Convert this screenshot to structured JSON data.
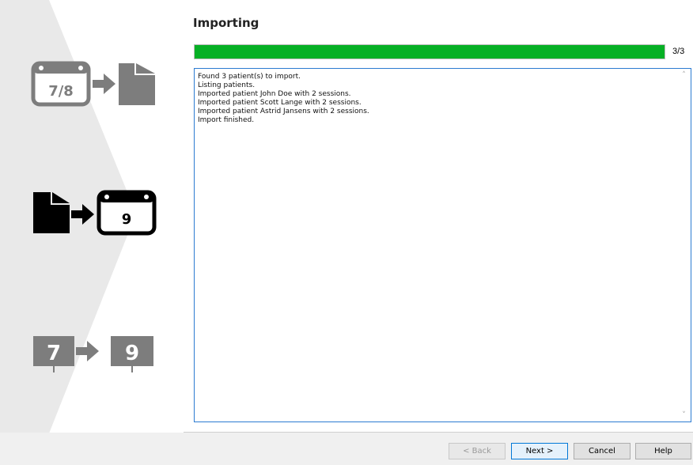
{
  "left_panel": {
    "steps": [
      {
        "name": "dicom-to-file",
        "version_label": "7/8"
      },
      {
        "name": "file-to-dicom9",
        "version_label": "9"
      },
      {
        "name": "version-7-to-9",
        "from_label": "7",
        "to_label": "9"
      }
    ]
  },
  "header": {
    "title": "Importing"
  },
  "progress": {
    "fraction": 1.0,
    "count_label": "3/3",
    "color": "#06b025"
  },
  "log": {
    "lines": [
      "Found 3 patient(s) to import.",
      "Listing patients.",
      "Imported patient John Doe with 2 sessions.",
      "Imported patient Scott Lange with 2 sessions.",
      "Imported patient Astrid Jansens with 2 sessions.",
      "Import finished."
    ]
  },
  "footer": {
    "back_label": "< Back",
    "next_label": "Next >",
    "cancel_label": "Cancel",
    "help_label": "Help"
  }
}
